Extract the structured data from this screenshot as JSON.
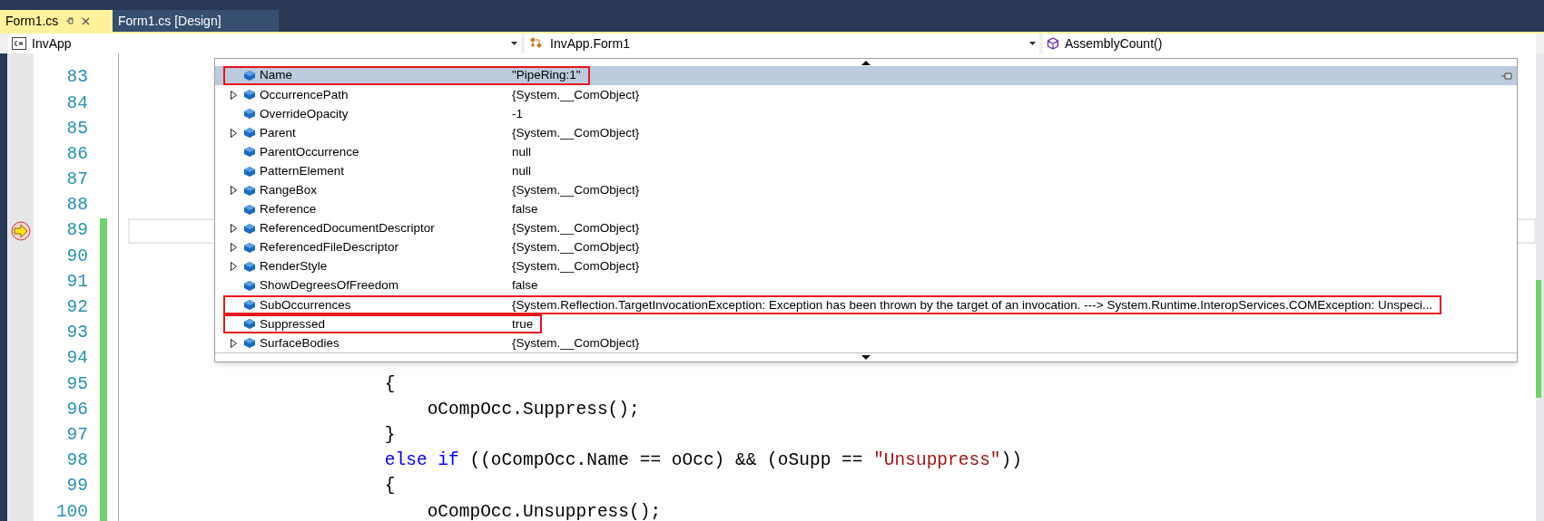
{
  "tabs": [
    {
      "label": "Form1.cs",
      "selected": true
    },
    {
      "label": "Form1.cs [Design]",
      "selected": false
    }
  ],
  "nav_bar": [
    {
      "label": "InvApp",
      "kind": "project"
    },
    {
      "label": "InvApp.Form1",
      "kind": "class"
    },
    {
      "label": "AssemblyCount()",
      "kind": "method"
    }
  ],
  "editor": {
    "lines": [
      {
        "number": "83",
        "changed": false,
        "current": false
      },
      {
        "number": "84",
        "changed": false,
        "current": false
      },
      {
        "number": "85",
        "changed": false,
        "current": false
      },
      {
        "number": "86",
        "changed": false,
        "current": false
      },
      {
        "number": "87",
        "changed": false,
        "current": false
      },
      {
        "number": "88",
        "changed": false,
        "current": false
      },
      {
        "number": "89",
        "changed": true,
        "current": true
      },
      {
        "number": "90",
        "changed": true,
        "current": false
      },
      {
        "number": "91",
        "changed": true,
        "current": false
      },
      {
        "number": "92",
        "changed": true,
        "current": false
      },
      {
        "number": "93",
        "changed": true,
        "current": false
      },
      {
        "number": "94",
        "changed": true,
        "current": false
      },
      {
        "number": "95",
        "changed": true,
        "current": false,
        "tokens": [
          {
            "text": "                        {",
            "kind": "plain"
          }
        ]
      },
      {
        "number": "96",
        "changed": true,
        "current": false,
        "tokens": [
          {
            "text": "                            oCompOcc.Suppress();",
            "kind": "plain"
          }
        ]
      },
      {
        "number": "97",
        "changed": true,
        "current": false,
        "tokens": [
          {
            "text": "                        }",
            "kind": "plain"
          }
        ]
      },
      {
        "number": "98",
        "changed": true,
        "current": false,
        "tokens": [
          {
            "text": "                        else if",
            "kind": "keyword"
          },
          {
            "text": " ((oCompOcc.Name == oOcc) && (oSupp == ",
            "kind": "plain"
          },
          {
            "text": "\"Unsuppress\"",
            "kind": "string"
          },
          {
            "text": "))",
            "kind": "plain"
          }
        ]
      },
      {
        "number": "99",
        "changed": true,
        "current": false,
        "tokens": [
          {
            "text": "                        {",
            "kind": "plain"
          }
        ]
      },
      {
        "number": "100",
        "changed": true,
        "current": false,
        "tokens": [
          {
            "text": "                            oCompOcc.Unsuppress();",
            "kind": "plain"
          }
        ]
      }
    ]
  },
  "data_tip": {
    "rows": [
      {
        "name": "Name",
        "value": "\"PipeRing:1\"",
        "expandable": false,
        "selected": true,
        "outlined": true
      },
      {
        "name": "OccurrencePath",
        "value": "{System.__ComObject}",
        "expandable": true,
        "selected": false,
        "outlined": false
      },
      {
        "name": "OverrideOpacity",
        "value": "-1",
        "expandable": false,
        "selected": false,
        "outlined": false
      },
      {
        "name": "Parent",
        "value": "{System.__ComObject}",
        "expandable": true,
        "selected": false,
        "outlined": false
      },
      {
        "name": "ParentOccurrence",
        "value": "null",
        "expandable": false,
        "selected": false,
        "outlined": false
      },
      {
        "name": "PatternElement",
        "value": "null",
        "expandable": false,
        "selected": false,
        "outlined": false
      },
      {
        "name": "RangeBox",
        "value": "{System.__ComObject}",
        "expandable": true,
        "selected": false,
        "outlined": false
      },
      {
        "name": "Reference",
        "value": "false",
        "expandable": false,
        "selected": false,
        "outlined": false
      },
      {
        "name": "ReferencedDocumentDescriptor",
        "value": "{System.__ComObject}",
        "expandable": true,
        "selected": false,
        "outlined": false
      },
      {
        "name": "ReferencedFileDescriptor",
        "value": "{System.__ComObject}",
        "expandable": true,
        "selected": false,
        "outlined": false
      },
      {
        "name": "RenderStyle",
        "value": "{System.__ComObject}",
        "expandable": true,
        "selected": false,
        "outlined": false
      },
      {
        "name": "ShowDegreesOfFreedom",
        "value": "false",
        "expandable": false,
        "selected": false,
        "outlined": false
      },
      {
        "name": "SubOccurrences",
        "value": "{System.Reflection.TargetInvocationException: Exception has been thrown by the target of an invocation. ---> System.Runtime.InteropServices.COMException: Unspeci...",
        "expandable": false,
        "selected": false,
        "outlined": true
      },
      {
        "name": "Suppressed",
        "value": "true",
        "expandable": false,
        "selected": false,
        "outlined": true
      },
      {
        "name": "SurfaceBodies",
        "value": "{System.__ComObject}",
        "expandable": true,
        "selected": false,
        "outlined": false
      }
    ]
  }
}
